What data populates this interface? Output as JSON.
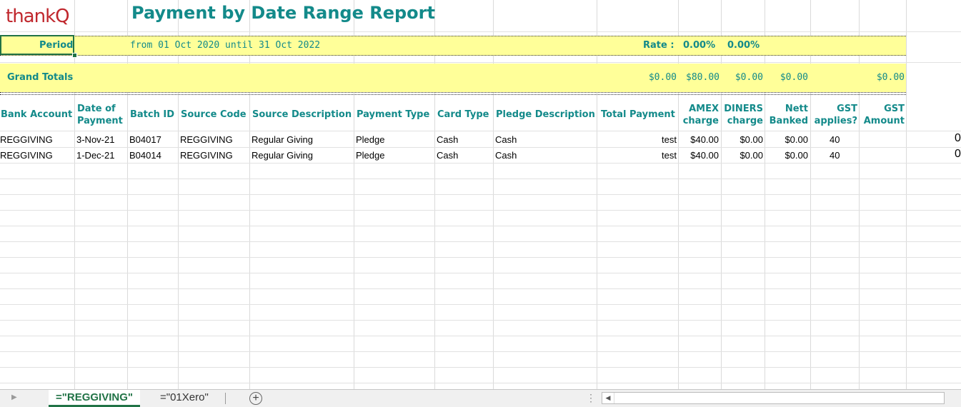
{
  "report": {
    "logo_text": "thankQ",
    "title": "Payment by Date Range Report",
    "period_label": "Period",
    "period_value": "from 01 Oct 2020 until 31 Oct 2022",
    "rate_label": "Rate :",
    "rate_1": "0.00%",
    "rate_2": "0.00%",
    "grand_totals_label": "Grand Totals",
    "grand_totals": {
      "total_payment": "$0.00",
      "amex": "$80.00",
      "diners": "$0.00",
      "nett": "$0.00",
      "gst_amount": "$0.00"
    }
  },
  "columns": {
    "bank_account": [
      "Bank Account"
    ],
    "date_of_payment": [
      "Date of",
      "Payment"
    ],
    "batch_id": [
      "Batch ID"
    ],
    "source_code": [
      "Source Code"
    ],
    "source_description": [
      "Source Description"
    ],
    "payment_type": [
      "Payment Type"
    ],
    "card_type": [
      "Card Type"
    ],
    "pledge_description": [
      "Pledge Description"
    ],
    "total_payment": [
      "Total Payment"
    ],
    "amex": [
      "AMEX",
      "charge"
    ],
    "diners": [
      "DINERS",
      "charge"
    ],
    "nett": [
      "Nett",
      "Banked"
    ],
    "gst_applies": [
      "GST",
      "applies?"
    ],
    "gst_amount": [
      "GST",
      "Amount"
    ]
  },
  "rows": [
    {
      "bank_account": "REGGIVING",
      "date": "3-Nov-21",
      "batch_id": "B04017",
      "source_code": "REGGIVING",
      "source_description": "Regular Giving",
      "payment_type": "Pledge",
      "card_type": "Cash",
      "pledge_description": "Cash",
      "total_payment": "test",
      "amex": "$40.00",
      "diners": "$0.00",
      "nett": "$0.00",
      "gst_applies": "40",
      "gst_amount": "",
      "extra": "0"
    },
    {
      "bank_account": "REGGIVING",
      "date": "1-Dec-21",
      "batch_id": "B04014",
      "source_code": "REGGIVING",
      "source_description": "Regular Giving",
      "payment_type": "Pledge",
      "card_type": "Cash",
      "pledge_description": "Cash",
      "total_payment": "test",
      "amex": "$40.00",
      "diners": "$0.00",
      "nett": "$0.00",
      "gst_applies": "40",
      "gst_amount": "",
      "extra": "0"
    }
  ],
  "tabs": [
    {
      "label": "=\"REGGIVING\"",
      "active": true
    },
    {
      "label": "=\"01Xero\"",
      "active": false
    }
  ],
  "icons": {
    "add_sheet": "plus-circle-icon",
    "scroll_left": "triangle-left-icon",
    "tab_nav": "triangle-right-icon",
    "split": "vertical-ellipsis-icon"
  },
  "colors": {
    "accent": "#138a8a",
    "logo": "#c0272d",
    "band": "#ffff99",
    "excel_green": "#217346"
  }
}
